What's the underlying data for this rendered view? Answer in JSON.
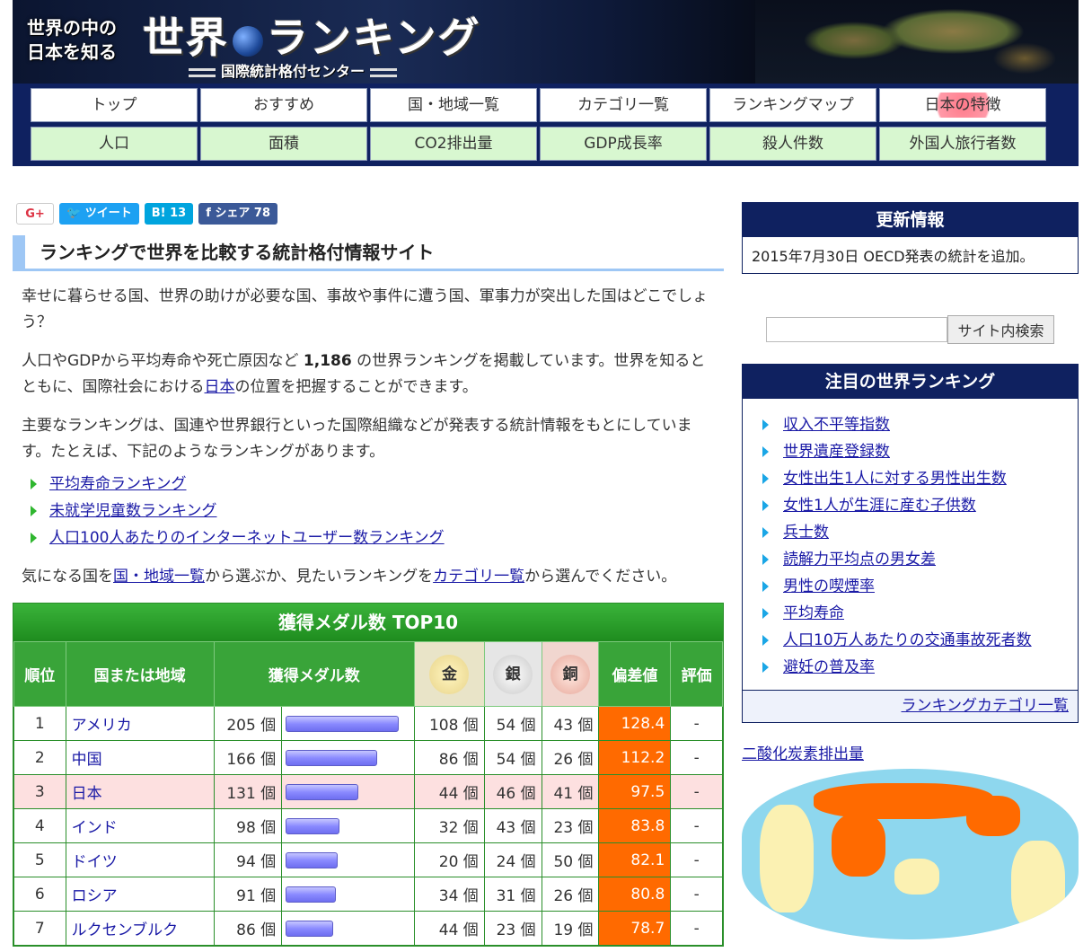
{
  "banner": {
    "tagline_1": "世界の中の",
    "tagline_2": "日本を知る",
    "brand_left": "世界",
    "brand_right": "ランキング",
    "subtitle": "国際統計格付センター"
  },
  "nav": {
    "top": [
      "トップ",
      "おすすめ",
      "国・地域一覧",
      "カテゴリ一覧",
      "ランキングマップ",
      "日本の特徴"
    ],
    "bottom": [
      "人口",
      "面積",
      "CO2排出量",
      "GDP成長率",
      "殺人件数",
      "外国人旅行者数"
    ]
  },
  "social": {
    "gplus": "G+",
    "tweet": "ツイート",
    "hatena": "B! 13",
    "share": "シェア 78"
  },
  "main": {
    "heading": "ランキングで世界を比較する統計格付情報サイト",
    "p1": "幸せに暮らせる国、世界の助けが必要な国、事故や事件に遭う国、軍事力が突出した国はどこでしょう？",
    "p2_a": "人口やGDPから平均寿命や死亡原因など ",
    "p2_count": "1,186",
    "p2_b": " の世界ランキングを掲載しています。世界を知るとともに、国際社会における",
    "p2_link": "日本",
    "p2_c": "の位置を把握することができます。",
    "p3": "主要なランキングは、国連や世界銀行といった国際組織などが発表する統計情報をもとにしています。たとえば、下記のようなランキングがあります。",
    "links": [
      "平均寿命ランキング",
      "未就学児童数ランキング",
      "人口100人あたりのインターネットユーザー数ランキング"
    ],
    "p4_a": "気になる国を",
    "p4_link1": "国・地域一覧",
    "p4_b": "から選ぶか、見たいランキングを",
    "p4_link2": "カテゴリ一覧",
    "p4_c": "から選んでください。"
  },
  "medals": {
    "title": "獲得メダル数 TOP10",
    "headers": {
      "rank": "順位",
      "country": "国または地域",
      "total": "獲得メダル数",
      "gold": "金",
      "silver": "銀",
      "bronze": "銅",
      "deviation": "偏差値",
      "rating": "評価"
    },
    "unit": "個",
    "max_total": 205,
    "rows": [
      {
        "rank": "1",
        "country": "アメリカ",
        "total": 205,
        "gold": 108,
        "silver": 54,
        "bronze": 43,
        "deviation": "128.4",
        "rating": "-"
      },
      {
        "rank": "2",
        "country": "中国",
        "total": 166,
        "gold": 86,
        "silver": 54,
        "bronze": 26,
        "deviation": "112.2",
        "rating": "-"
      },
      {
        "rank": "3",
        "country": "日本",
        "total": 131,
        "gold": 44,
        "silver": 46,
        "bronze": 41,
        "deviation": "97.5",
        "rating": "-"
      },
      {
        "rank": "4",
        "country": "インド",
        "total": 98,
        "gold": 32,
        "silver": 43,
        "bronze": 23,
        "deviation": "83.8",
        "rating": "-"
      },
      {
        "rank": "5",
        "country": "ドイツ",
        "total": 94,
        "gold": 20,
        "silver": 24,
        "bronze": 50,
        "deviation": "82.1",
        "rating": "-"
      },
      {
        "rank": "6",
        "country": "ロシア",
        "total": 91,
        "gold": 34,
        "silver": 31,
        "bronze": 26,
        "deviation": "80.8",
        "rating": "-"
      },
      {
        "rank": "7",
        "country": "ルクセンブルク",
        "total": 86,
        "gold": 44,
        "silver": 23,
        "bronze": 19,
        "deviation": "78.7",
        "rating": "-"
      }
    ]
  },
  "side": {
    "update_title": "更新情報",
    "update_text": "2015年7月30日 OECD発表の統計を追加。",
    "search_button": "サイト内検索",
    "featured_title": "注目の世界ランキング",
    "featured": [
      "収入不平等指数",
      "世界遺産登録数",
      "女性出生1人に対する男性出生数",
      "女性1人が生涯に産む子供数",
      "兵士数",
      "読解力平均点の男女差",
      "男性の喫煙率",
      "平均寿命",
      "人口10万人あたりの交通事故死者数",
      "避妊の普及率"
    ],
    "category_link": "ランキングカテゴリ一覧",
    "map_title": "二酸化炭素排出量"
  }
}
